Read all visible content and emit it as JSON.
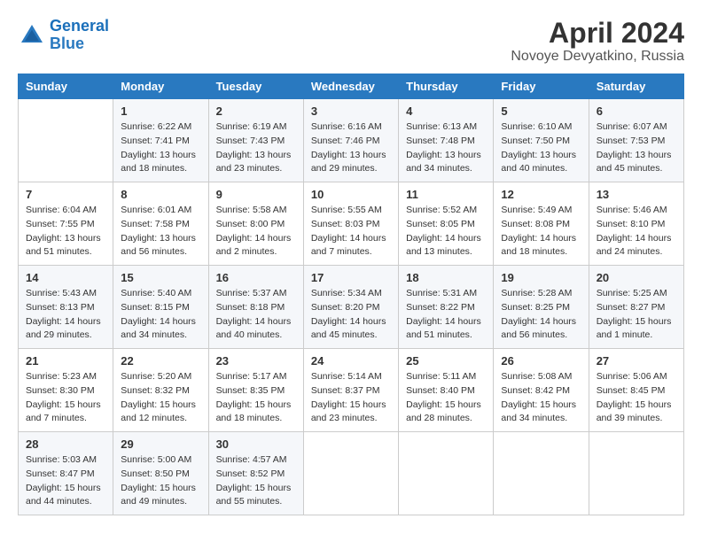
{
  "logo": {
    "line1": "General",
    "line2": "Blue"
  },
  "title": "April 2024",
  "subtitle": "Novoye Devyatkino, Russia",
  "days_of_week": [
    "Sunday",
    "Monday",
    "Tuesday",
    "Wednesday",
    "Thursday",
    "Friday",
    "Saturday"
  ],
  "weeks": [
    [
      {
        "num": "",
        "info": ""
      },
      {
        "num": "1",
        "info": "Sunrise: 6:22 AM\nSunset: 7:41 PM\nDaylight: 13 hours\nand 18 minutes."
      },
      {
        "num": "2",
        "info": "Sunrise: 6:19 AM\nSunset: 7:43 PM\nDaylight: 13 hours\nand 23 minutes."
      },
      {
        "num": "3",
        "info": "Sunrise: 6:16 AM\nSunset: 7:46 PM\nDaylight: 13 hours\nand 29 minutes."
      },
      {
        "num": "4",
        "info": "Sunrise: 6:13 AM\nSunset: 7:48 PM\nDaylight: 13 hours\nand 34 minutes."
      },
      {
        "num": "5",
        "info": "Sunrise: 6:10 AM\nSunset: 7:50 PM\nDaylight: 13 hours\nand 40 minutes."
      },
      {
        "num": "6",
        "info": "Sunrise: 6:07 AM\nSunset: 7:53 PM\nDaylight: 13 hours\nand 45 minutes."
      }
    ],
    [
      {
        "num": "7",
        "info": "Sunrise: 6:04 AM\nSunset: 7:55 PM\nDaylight: 13 hours\nand 51 minutes."
      },
      {
        "num": "8",
        "info": "Sunrise: 6:01 AM\nSunset: 7:58 PM\nDaylight: 13 hours\nand 56 minutes."
      },
      {
        "num": "9",
        "info": "Sunrise: 5:58 AM\nSunset: 8:00 PM\nDaylight: 14 hours\nand 2 minutes."
      },
      {
        "num": "10",
        "info": "Sunrise: 5:55 AM\nSunset: 8:03 PM\nDaylight: 14 hours\nand 7 minutes."
      },
      {
        "num": "11",
        "info": "Sunrise: 5:52 AM\nSunset: 8:05 PM\nDaylight: 14 hours\nand 13 minutes."
      },
      {
        "num": "12",
        "info": "Sunrise: 5:49 AM\nSunset: 8:08 PM\nDaylight: 14 hours\nand 18 minutes."
      },
      {
        "num": "13",
        "info": "Sunrise: 5:46 AM\nSunset: 8:10 PM\nDaylight: 14 hours\nand 24 minutes."
      }
    ],
    [
      {
        "num": "14",
        "info": "Sunrise: 5:43 AM\nSunset: 8:13 PM\nDaylight: 14 hours\nand 29 minutes."
      },
      {
        "num": "15",
        "info": "Sunrise: 5:40 AM\nSunset: 8:15 PM\nDaylight: 14 hours\nand 34 minutes."
      },
      {
        "num": "16",
        "info": "Sunrise: 5:37 AM\nSunset: 8:18 PM\nDaylight: 14 hours\nand 40 minutes."
      },
      {
        "num": "17",
        "info": "Sunrise: 5:34 AM\nSunset: 8:20 PM\nDaylight: 14 hours\nand 45 minutes."
      },
      {
        "num": "18",
        "info": "Sunrise: 5:31 AM\nSunset: 8:22 PM\nDaylight: 14 hours\nand 51 minutes."
      },
      {
        "num": "19",
        "info": "Sunrise: 5:28 AM\nSunset: 8:25 PM\nDaylight: 14 hours\nand 56 minutes."
      },
      {
        "num": "20",
        "info": "Sunrise: 5:25 AM\nSunset: 8:27 PM\nDaylight: 15 hours\nand 1 minute."
      }
    ],
    [
      {
        "num": "21",
        "info": "Sunrise: 5:23 AM\nSunset: 8:30 PM\nDaylight: 15 hours\nand 7 minutes."
      },
      {
        "num": "22",
        "info": "Sunrise: 5:20 AM\nSunset: 8:32 PM\nDaylight: 15 hours\nand 12 minutes."
      },
      {
        "num": "23",
        "info": "Sunrise: 5:17 AM\nSunset: 8:35 PM\nDaylight: 15 hours\nand 18 minutes."
      },
      {
        "num": "24",
        "info": "Sunrise: 5:14 AM\nSunset: 8:37 PM\nDaylight: 15 hours\nand 23 minutes."
      },
      {
        "num": "25",
        "info": "Sunrise: 5:11 AM\nSunset: 8:40 PM\nDaylight: 15 hours\nand 28 minutes."
      },
      {
        "num": "26",
        "info": "Sunrise: 5:08 AM\nSunset: 8:42 PM\nDaylight: 15 hours\nand 34 minutes."
      },
      {
        "num": "27",
        "info": "Sunrise: 5:06 AM\nSunset: 8:45 PM\nDaylight: 15 hours\nand 39 minutes."
      }
    ],
    [
      {
        "num": "28",
        "info": "Sunrise: 5:03 AM\nSunset: 8:47 PM\nDaylight: 15 hours\nand 44 minutes."
      },
      {
        "num": "29",
        "info": "Sunrise: 5:00 AM\nSunset: 8:50 PM\nDaylight: 15 hours\nand 49 minutes."
      },
      {
        "num": "30",
        "info": "Sunrise: 4:57 AM\nSunset: 8:52 PM\nDaylight: 15 hours\nand 55 minutes."
      },
      {
        "num": "",
        "info": ""
      },
      {
        "num": "",
        "info": ""
      },
      {
        "num": "",
        "info": ""
      },
      {
        "num": "",
        "info": ""
      }
    ]
  ]
}
